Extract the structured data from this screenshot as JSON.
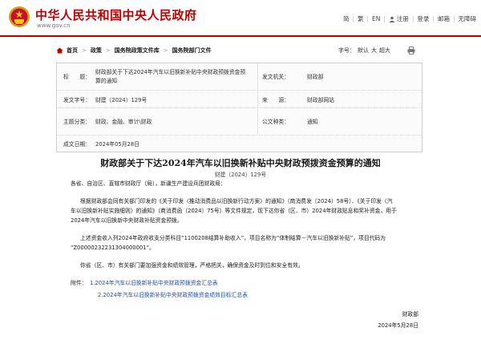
{
  "header": {
    "site_title": "中华人民共和国中央人民政府",
    "site_url": "www.gov.cn",
    "nav": [
      "简",
      "繁",
      "EN",
      "注册",
      "登录",
      "邮箱",
      "无障碍"
    ],
    "brand_color": "#c00000"
  },
  "breadcrumb": {
    "items": [
      "首页",
      "政策",
      "国务院政策文件库",
      "国务院部门文件"
    ]
  },
  "font_size": {
    "label": "字号：",
    "small": "默认",
    "large": "大",
    "xlarge": "超大"
  },
  "meta": {
    "title_label": "标　　题：",
    "title_value_line1": "财政部关于下达2024年汽车以旧换新补贴中央财政预拨资金预",
    "title_value_line2": "算的通知",
    "issuer_label": "发文机关：",
    "issuer_value": "财政部",
    "docnum_label": "发文字号：",
    "docnum_value": "财建〔2024〕129号",
    "source_label": "来　　源：",
    "source_value": "财政部网站",
    "topic_label": "主题分类：",
    "topic_value": "财政、金融、审计\\财政",
    "type_label": "公文种类：",
    "type_value": "通知",
    "date_label": "成文日期：",
    "date_value": "2024年05月28日"
  },
  "document": {
    "title": "财政部关于下达2024年汽车以旧换新补贴中央财政预拨资金预算的通知",
    "number": "财建〔2024〕129号",
    "salutation": "各省、自治区、直辖市财政厅（局），新疆生产建设兵团财政局：",
    "p1_l1": "根据财政部会同有关部门印发的《关于印发〈推动消费品以旧换新行动方案〉的通知》（商消费发〔2024〕58号）、《关于印发〈汽",
    "p1_l2": "车以旧换新补贴实施细则〉的通知》（商消费函〔2024〕75号）等文件规定，现下达你省（区、市）2024年财政贴息和奖补资金，用于",
    "p1_l3": "2024年汽车以旧换新中央财政补贴资金预拨。",
    "p2_l1": "上述资金收入列2024年政府收支分类科目“1100208结算补助收入”，项目名称为“体制结算－汽车以旧换新补贴”，项目代码为",
    "p2_l2": "“Z00000232231304000001”。",
    "p3": "你省（区、市）有关部门要加强资金和绩效管理，严格把关，确保资金及时到位和安全有效。",
    "attach_label": "附件：",
    "attachments": [
      "1.2024年汽车以旧换新补贴中央财政预拨资金汇总表",
      "2.2024年汽车以旧换新补贴中央财政预拨资金绩效目标汇总表"
    ],
    "signature": "财政部",
    "sign_date": "2024年5月28日"
  }
}
